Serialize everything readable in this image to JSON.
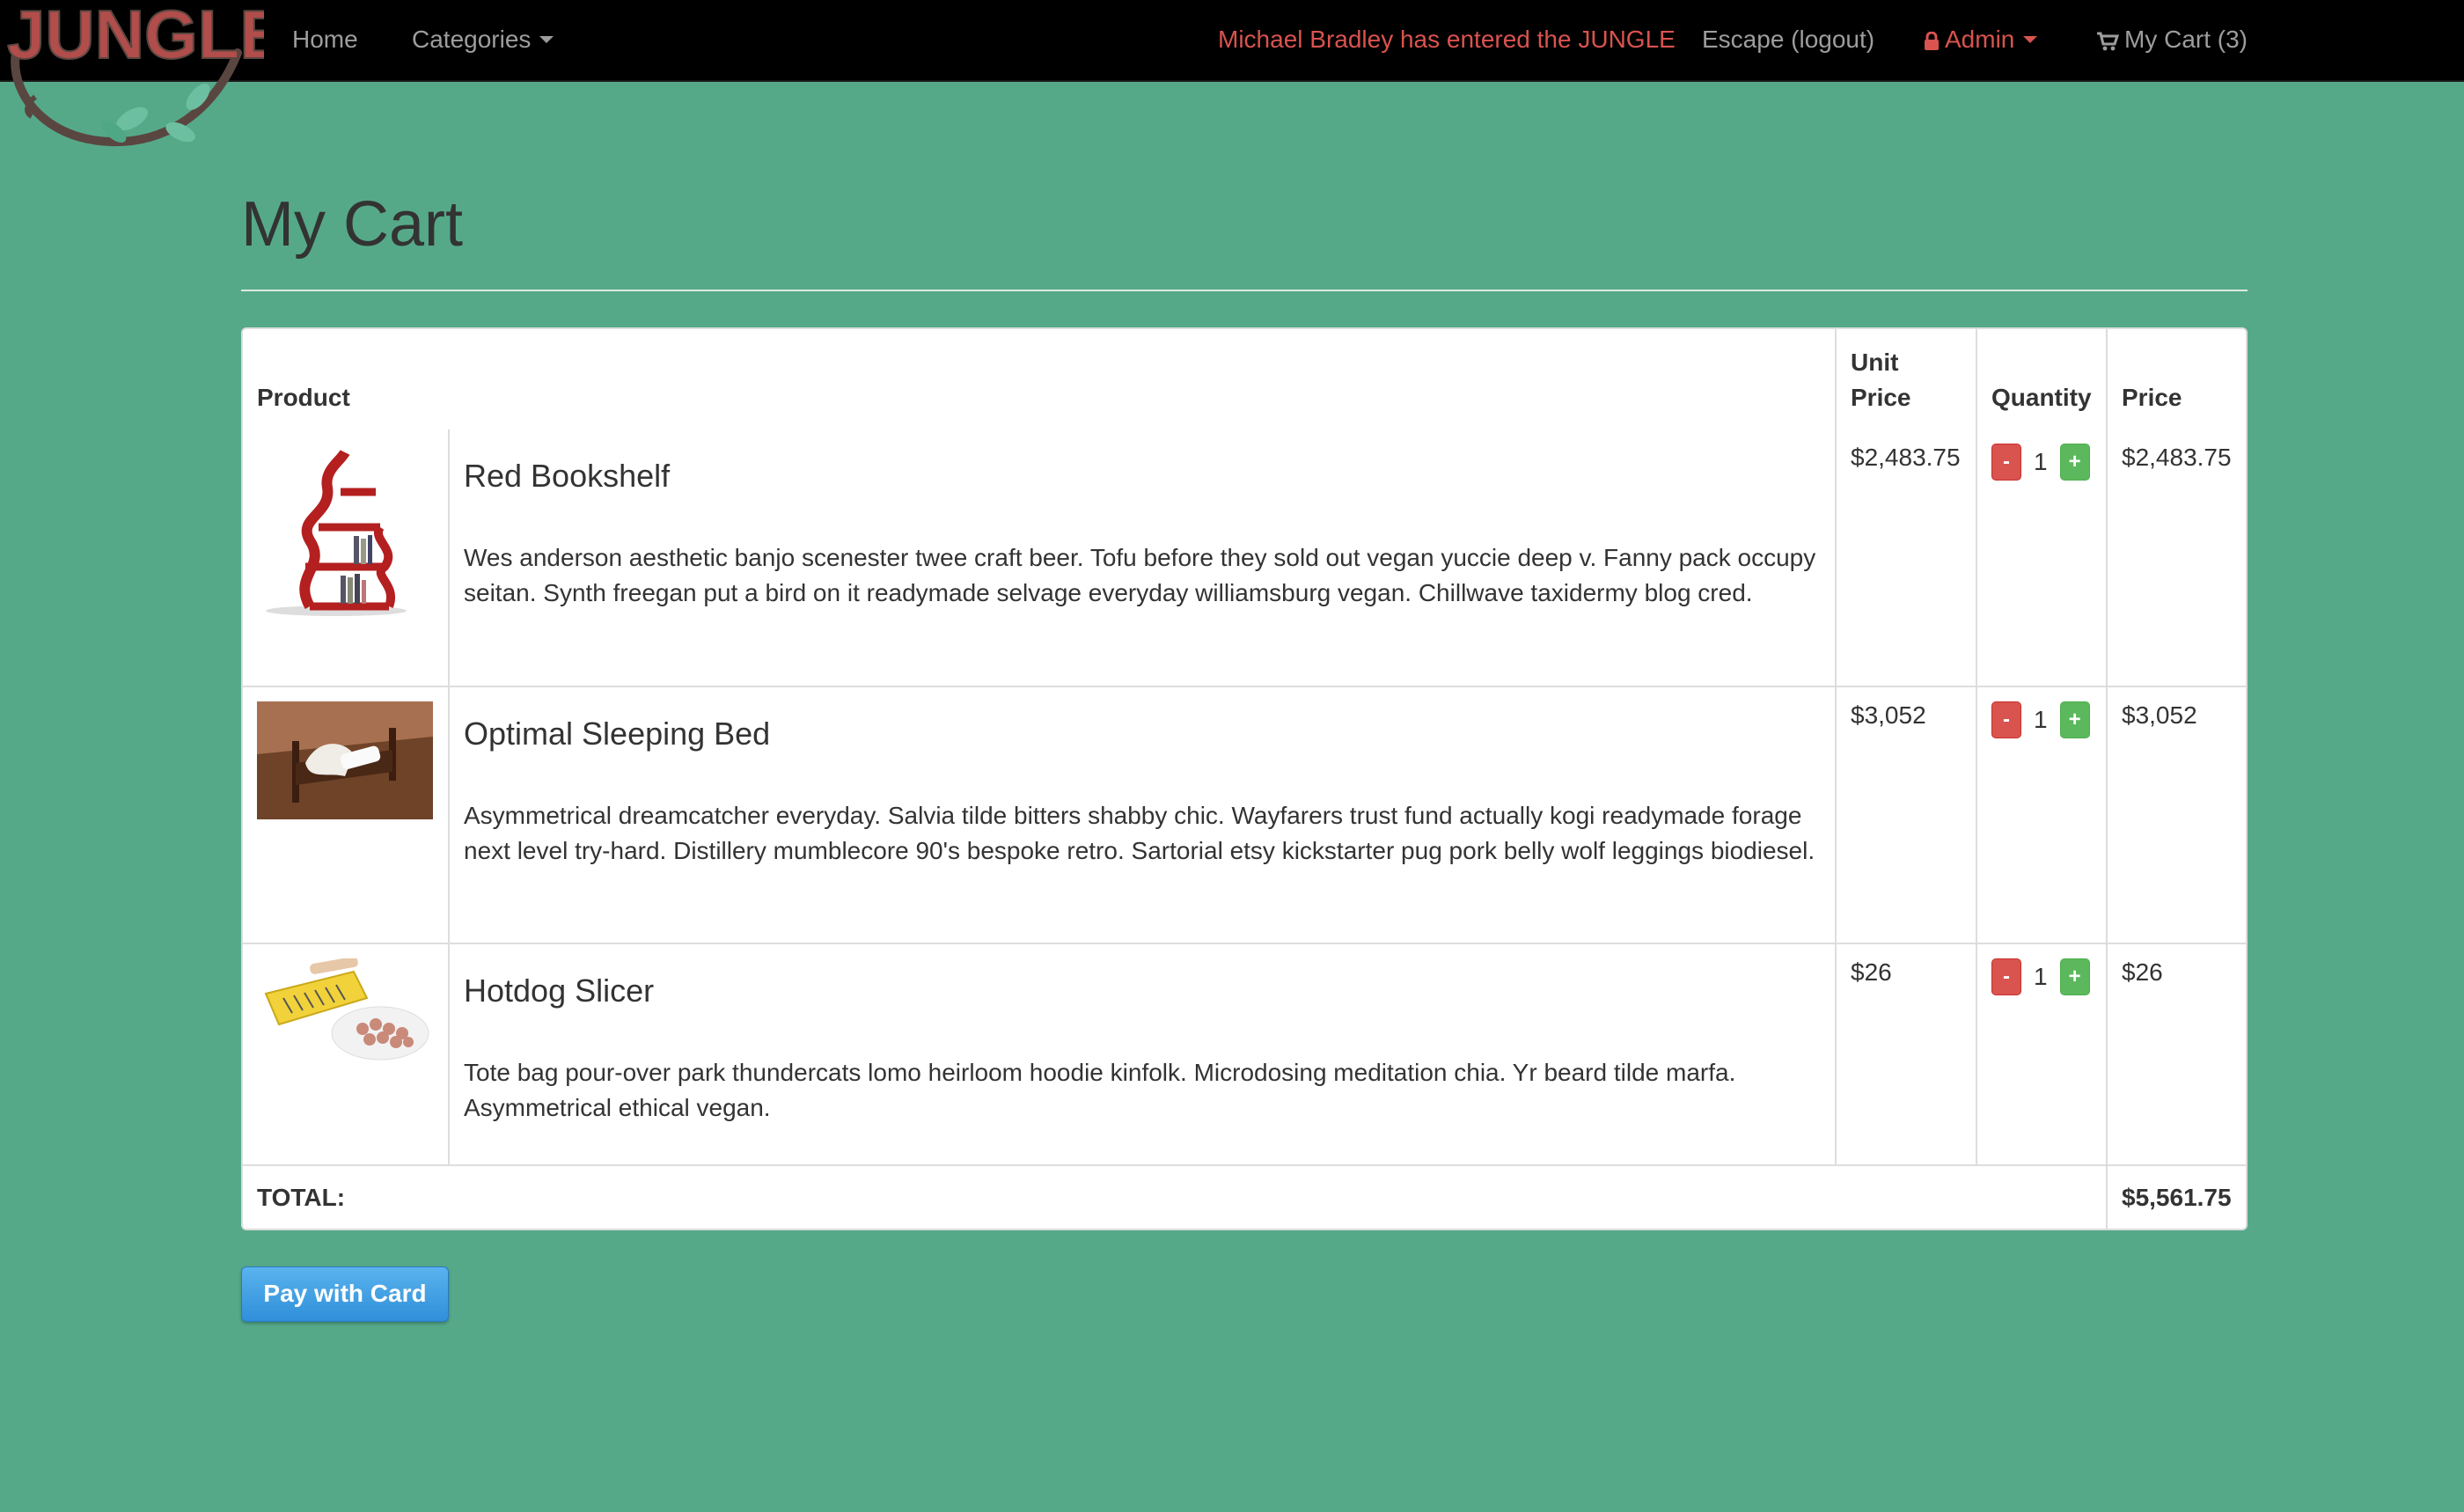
{
  "navbar": {
    "logo_text": "JUNGLE",
    "home": "Home",
    "categories": "Categories",
    "welcome": "Michael Bradley has entered the JUNGLE",
    "logout": "Escape (logout)",
    "admin": "Admin",
    "cart": "My Cart (3)"
  },
  "page": {
    "title": "My Cart"
  },
  "table": {
    "headers": {
      "product": "Product",
      "unit_price": "Unit Price",
      "quantity": "Quantity",
      "price": "Price"
    },
    "rows": [
      {
        "name": "Red Bookshelf",
        "description": "Wes anderson aesthetic banjo scenester twee craft beer. Tofu before they sold out vegan yuccie deep v. Fanny pack occupy seitan. Synth freegan put a bird on it readymade selvage everyday williamsburg vegan. Chillwave taxidermy blog cred.",
        "unit_price": "$2,483.75",
        "quantity": "1",
        "price": "$2,483.75"
      },
      {
        "name": "Optimal Sleeping Bed",
        "description": "Asymmetrical dreamcatcher everyday. Salvia tilde bitters shabby chic. Wayfarers trust fund actually kogi readymade forage next level try-hard. Distillery mumblecore 90's bespoke retro. Sartorial etsy kickstarter pug pork belly wolf leggings biodiesel.",
        "unit_price": "$3,052",
        "quantity": "1",
        "price": "$3,052"
      },
      {
        "name": "Hotdog Slicer",
        "description": "Tote bag pour-over park thundercats lomo heirloom hoodie kinfolk. Microdosing meditation chia. Yr beard tilde marfa. Asymmetrical ethical vegan.",
        "unit_price": "$26",
        "quantity": "1",
        "price": "$26"
      }
    ],
    "minus_label": "-",
    "plus_label": "+",
    "total_label": "TOTAL:",
    "total_value": "$5,561.75"
  },
  "actions": {
    "pay": "Pay with Card"
  },
  "colors": {
    "background": "#55a989",
    "navbar": "#000000",
    "accent_red": "#d9534f",
    "accent_green": "#5cb85c",
    "pay_blue": "#3a9be3"
  }
}
